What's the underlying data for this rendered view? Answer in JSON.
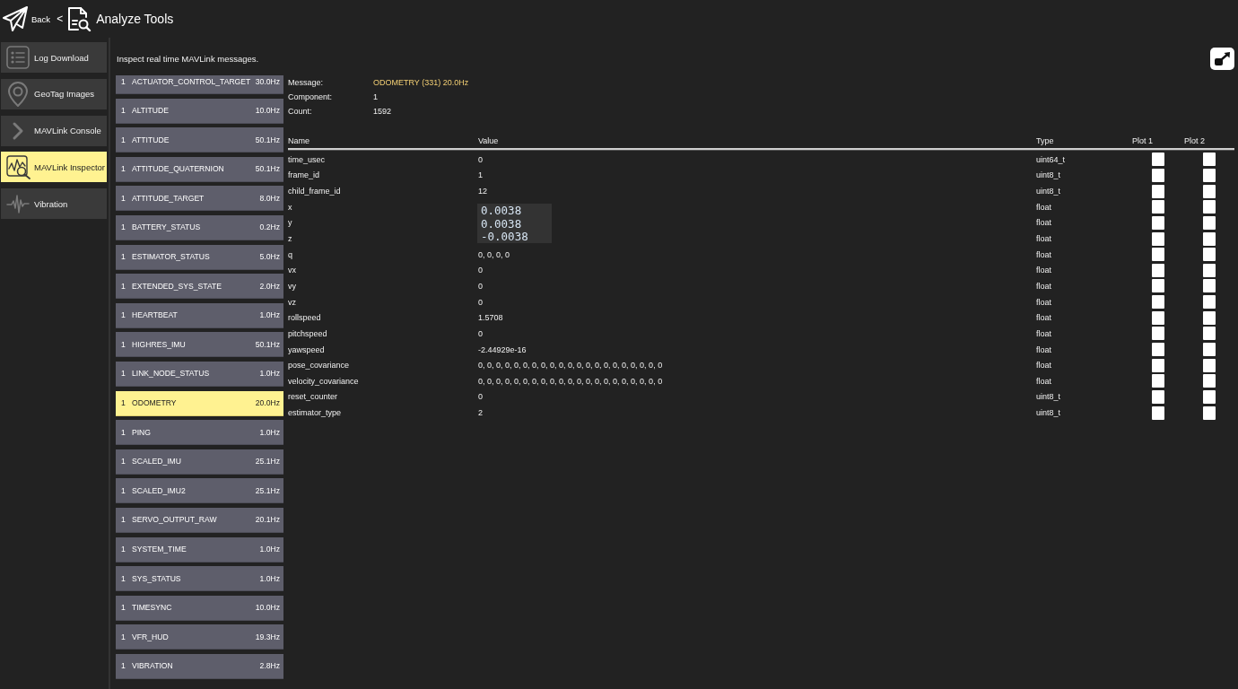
{
  "header": {
    "back_label": "Back",
    "separator": "<",
    "title": "Analyze Tools"
  },
  "sidebar": {
    "items": [
      {
        "label": "Log Download",
        "selected": false
      },
      {
        "label": "GeoTag Images",
        "selected": false
      },
      {
        "label": "MAVLink Console",
        "selected": false
      },
      {
        "label": "MAVLink Inspector",
        "selected": true
      },
      {
        "label": "Vibration",
        "selected": false
      }
    ]
  },
  "description": "Inspect real time MAVLink messages.",
  "messages": [
    {
      "component": "1",
      "name": "ACTUATOR_CONTROL_TARGET",
      "rate": "30.0Hz",
      "selected": false
    },
    {
      "component": "1",
      "name": "ALTITUDE",
      "rate": "10.0Hz",
      "selected": false
    },
    {
      "component": "1",
      "name": "ATTITUDE",
      "rate": "50.1Hz",
      "selected": false
    },
    {
      "component": "1",
      "name": "ATTITUDE_QUATERNION",
      "rate": "50.1Hz",
      "selected": false
    },
    {
      "component": "1",
      "name": "ATTITUDE_TARGET",
      "rate": "8.0Hz",
      "selected": false
    },
    {
      "component": "1",
      "name": "BATTERY_STATUS",
      "rate": "0.2Hz",
      "selected": false
    },
    {
      "component": "1",
      "name": "ESTIMATOR_STATUS",
      "rate": "5.0Hz",
      "selected": false
    },
    {
      "component": "1",
      "name": "EXTENDED_SYS_STATE",
      "rate": "2.0Hz",
      "selected": false
    },
    {
      "component": "1",
      "name": "HEARTBEAT",
      "rate": "1.0Hz",
      "selected": false
    },
    {
      "component": "1",
      "name": "HIGHRES_IMU",
      "rate": "50.1Hz",
      "selected": false
    },
    {
      "component": "1",
      "name": "LINK_NODE_STATUS",
      "rate": "1.0Hz",
      "selected": false
    },
    {
      "component": "1",
      "name": "ODOMETRY",
      "rate": "20.0Hz",
      "selected": true
    },
    {
      "component": "1",
      "name": "PING",
      "rate": "1.0Hz",
      "selected": false
    },
    {
      "component": "1",
      "name": "SCALED_IMU",
      "rate": "25.1Hz",
      "selected": false
    },
    {
      "component": "1",
      "name": "SCALED_IMU2",
      "rate": "25.1Hz",
      "selected": false
    },
    {
      "component": "1",
      "name": "SERVO_OUTPUT_RAW",
      "rate": "20.1Hz",
      "selected": false
    },
    {
      "component": "1",
      "name": "SYSTEM_TIME",
      "rate": "1.0Hz",
      "selected": false
    },
    {
      "component": "1",
      "name": "SYS_STATUS",
      "rate": "1.0Hz",
      "selected": false
    },
    {
      "component": "1",
      "name": "TIMESYNC",
      "rate": "10.0Hz",
      "selected": false
    },
    {
      "component": "1",
      "name": "VFR_HUD",
      "rate": "19.3Hz",
      "selected": false
    },
    {
      "component": "1",
      "name": "VIBRATION",
      "rate": "2.8Hz",
      "selected": false
    }
  ],
  "details": {
    "fields": [
      {
        "label": "Message:",
        "value": "ODOMETRY (331) 20.0Hz",
        "highlighted": true
      },
      {
        "label": "Component:",
        "value": "1",
        "highlighted": false
      },
      {
        "label": "Count:",
        "value": "1592",
        "highlighted": false
      }
    ]
  },
  "table": {
    "columns": [
      "Name",
      "Value",
      "Type",
      "Plot 1",
      "Plot 2"
    ],
    "rows": [
      {
        "name": "time_usec",
        "value": "0",
        "type": "uint64_t",
        "plot1": false,
        "plot2": false
      },
      {
        "name": "frame_id",
        "value": "1",
        "type": "uint8_t",
        "plot1": false,
        "plot2": false
      },
      {
        "name": "child_frame_id",
        "value": "12",
        "type": "uint8_t",
        "plot1": false,
        "plot2": false
      },
      {
        "name": "x",
        "type": "float",
        "plot1": false,
        "plot2": false
      },
      {
        "name": "y",
        "type": "float",
        "plot1": false,
        "plot2": false
      },
      {
        "name": "z",
        "type": "float",
        "plot1": false,
        "plot2": false
      },
      {
        "name": "q",
        "value": "0, 0, 0, 0",
        "type": "float",
        "plot1": false,
        "plot2": false
      },
      {
        "name": "vx",
        "value": "0",
        "type": "float",
        "plot1": false,
        "plot2": false
      },
      {
        "name": "vy",
        "value": "0",
        "type": "float",
        "plot1": false,
        "plot2": false
      },
      {
        "name": "vz",
        "value": "0",
        "type": "float",
        "plot1": false,
        "plot2": false
      },
      {
        "name": "rollspeed",
        "value": "1.5708",
        "type": "float",
        "plot1": false,
        "plot2": false
      },
      {
        "name": "pitchspeed",
        "value": "0",
        "type": "float",
        "plot1": false,
        "plot2": false
      },
      {
        "name": "yawspeed",
        "value": "-2.44929e-16",
        "type": "float",
        "plot1": false,
        "plot2": false
      },
      {
        "name": "pose_covariance",
        "value": "0, 0, 0, 0, 0, 0, 0, 0, 0, 0, 0, 0, 0, 0, 0, 0, 0, 0, 0, 0, 0",
        "type": "float",
        "plot1": false,
        "plot2": false
      },
      {
        "name": "velocity_covariance",
        "value": "0, 0, 0, 0, 0, 0, 0, 0, 0, 0, 0, 0, 0, 0, 0, 0, 0, 0, 0, 0, 0",
        "type": "float",
        "plot1": false,
        "plot2": false
      },
      {
        "name": "reset_counter",
        "value": "0",
        "type": "uint8_t",
        "plot1": false,
        "plot2": false
      },
      {
        "name": "estimator_type",
        "value": "2",
        "type": "uint8_t",
        "plot1": false,
        "plot2": false
      }
    ],
    "overlay": {
      "lines": [
        "0.0038",
        "0.0038",
        "-0.0038"
      ]
    }
  }
}
